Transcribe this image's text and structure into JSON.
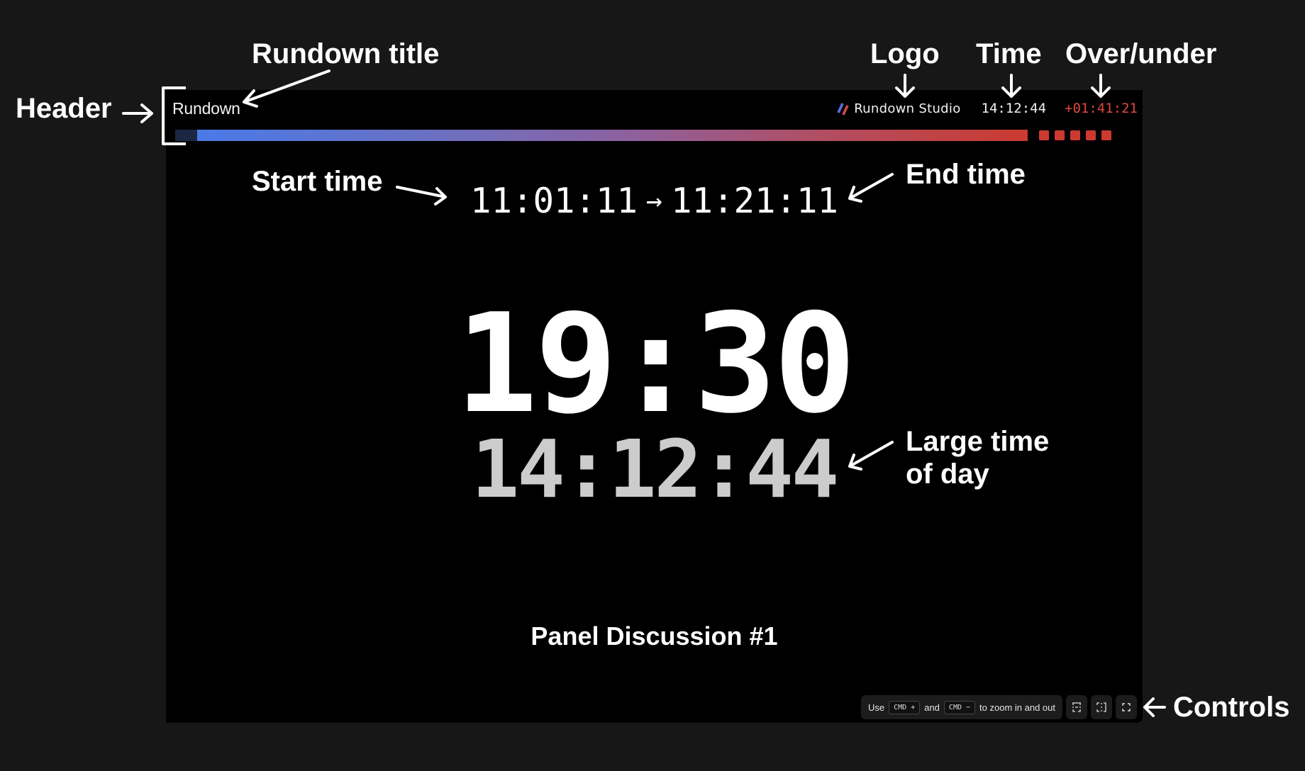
{
  "header": {
    "rundown_title": "Rundown",
    "logo_text": "Rundown Studio",
    "logo_icon": "slashes-logo-icon",
    "logo_colors": [
      "#5b6ee8",
      "#d24a44"
    ],
    "time": "14:12:44",
    "over_under": "+01:41:21",
    "over_under_color": "#e0473f"
  },
  "progress": {
    "fill_fraction": 0.975,
    "track_color": "#1c2744",
    "gradient_start": "#4a7ae8",
    "gradient_end": "#cc3a2f",
    "overtime_blocks": 5,
    "overtime_color": "#cc3a2f"
  },
  "cue": {
    "start_time": "11:01:11",
    "arrow": "→",
    "end_time": "11:21:11",
    "timer": "19:30",
    "time_of_day": "14:12:44",
    "title": "Panel Discussion #1"
  },
  "controls": {
    "hint_use": "Use",
    "key_zoom_in": "CMD +",
    "hint_and": "and",
    "key_zoom_out": "CMD −",
    "hint_suffix": "to zoom in and out",
    "buttons": [
      {
        "icon": "fit-height-icon"
      },
      {
        "icon": "fit-width-icon"
      },
      {
        "icon": "fullscreen-icon"
      }
    ]
  },
  "annotations": {
    "header": "Header",
    "rundown_title": "Rundown title",
    "logo": "Logo",
    "time": "Time",
    "over_under": "Over/under",
    "start_time": "Start time",
    "end_time": "End time",
    "large_time_line1": "Large time",
    "large_time_line2": "of day",
    "controls": "Controls"
  }
}
